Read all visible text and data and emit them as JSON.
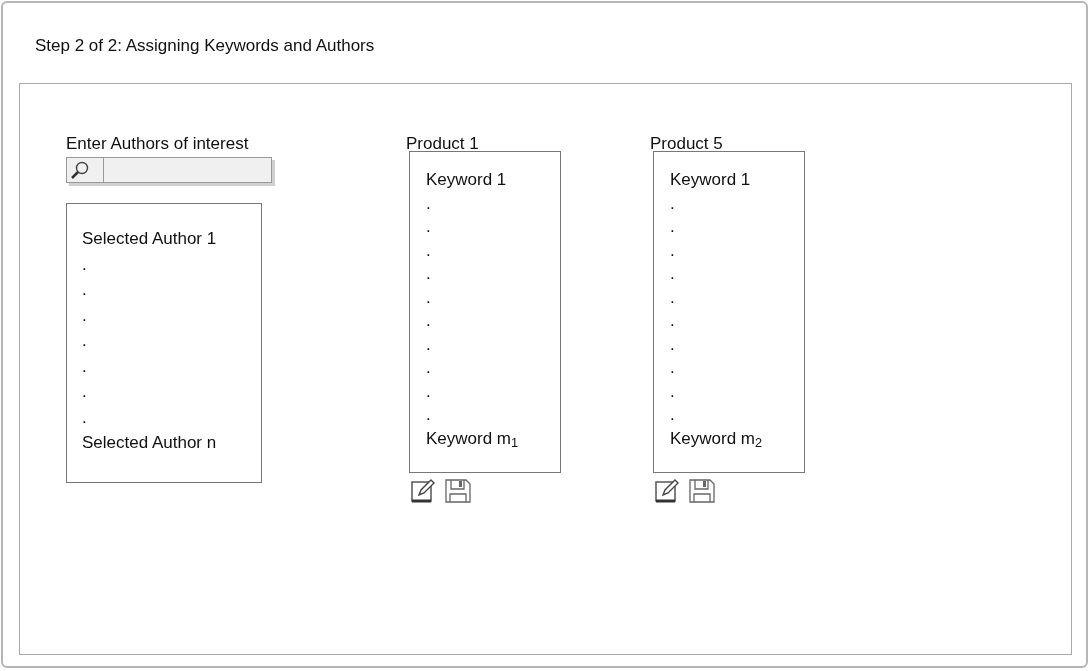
{
  "title": "Step 2 of 2: Assigning Keywords and Authors",
  "authors": {
    "label": "Enter Authors of interest",
    "items": [
      "Selected Author 1",
      ".",
      ".",
      ".",
      ".",
      ".",
      ".",
      ".",
      "Selected Author n"
    ]
  },
  "products": [
    {
      "title": "Product 1",
      "keywords": [
        "Keyword 1",
        ".",
        ".",
        ".",
        ".",
        ".",
        ".",
        ".",
        ".",
        ".",
        ".",
        "Keyword m$_{1}$"
      ]
    },
    {
      "title": "Product 5",
      "keywords": [
        "Keyword 1",
        ".",
        ".",
        ".",
        ".",
        ".",
        ".",
        ".",
        ".",
        ".",
        ".",
        "Keyword m$_{2}$"
      ]
    }
  ]
}
